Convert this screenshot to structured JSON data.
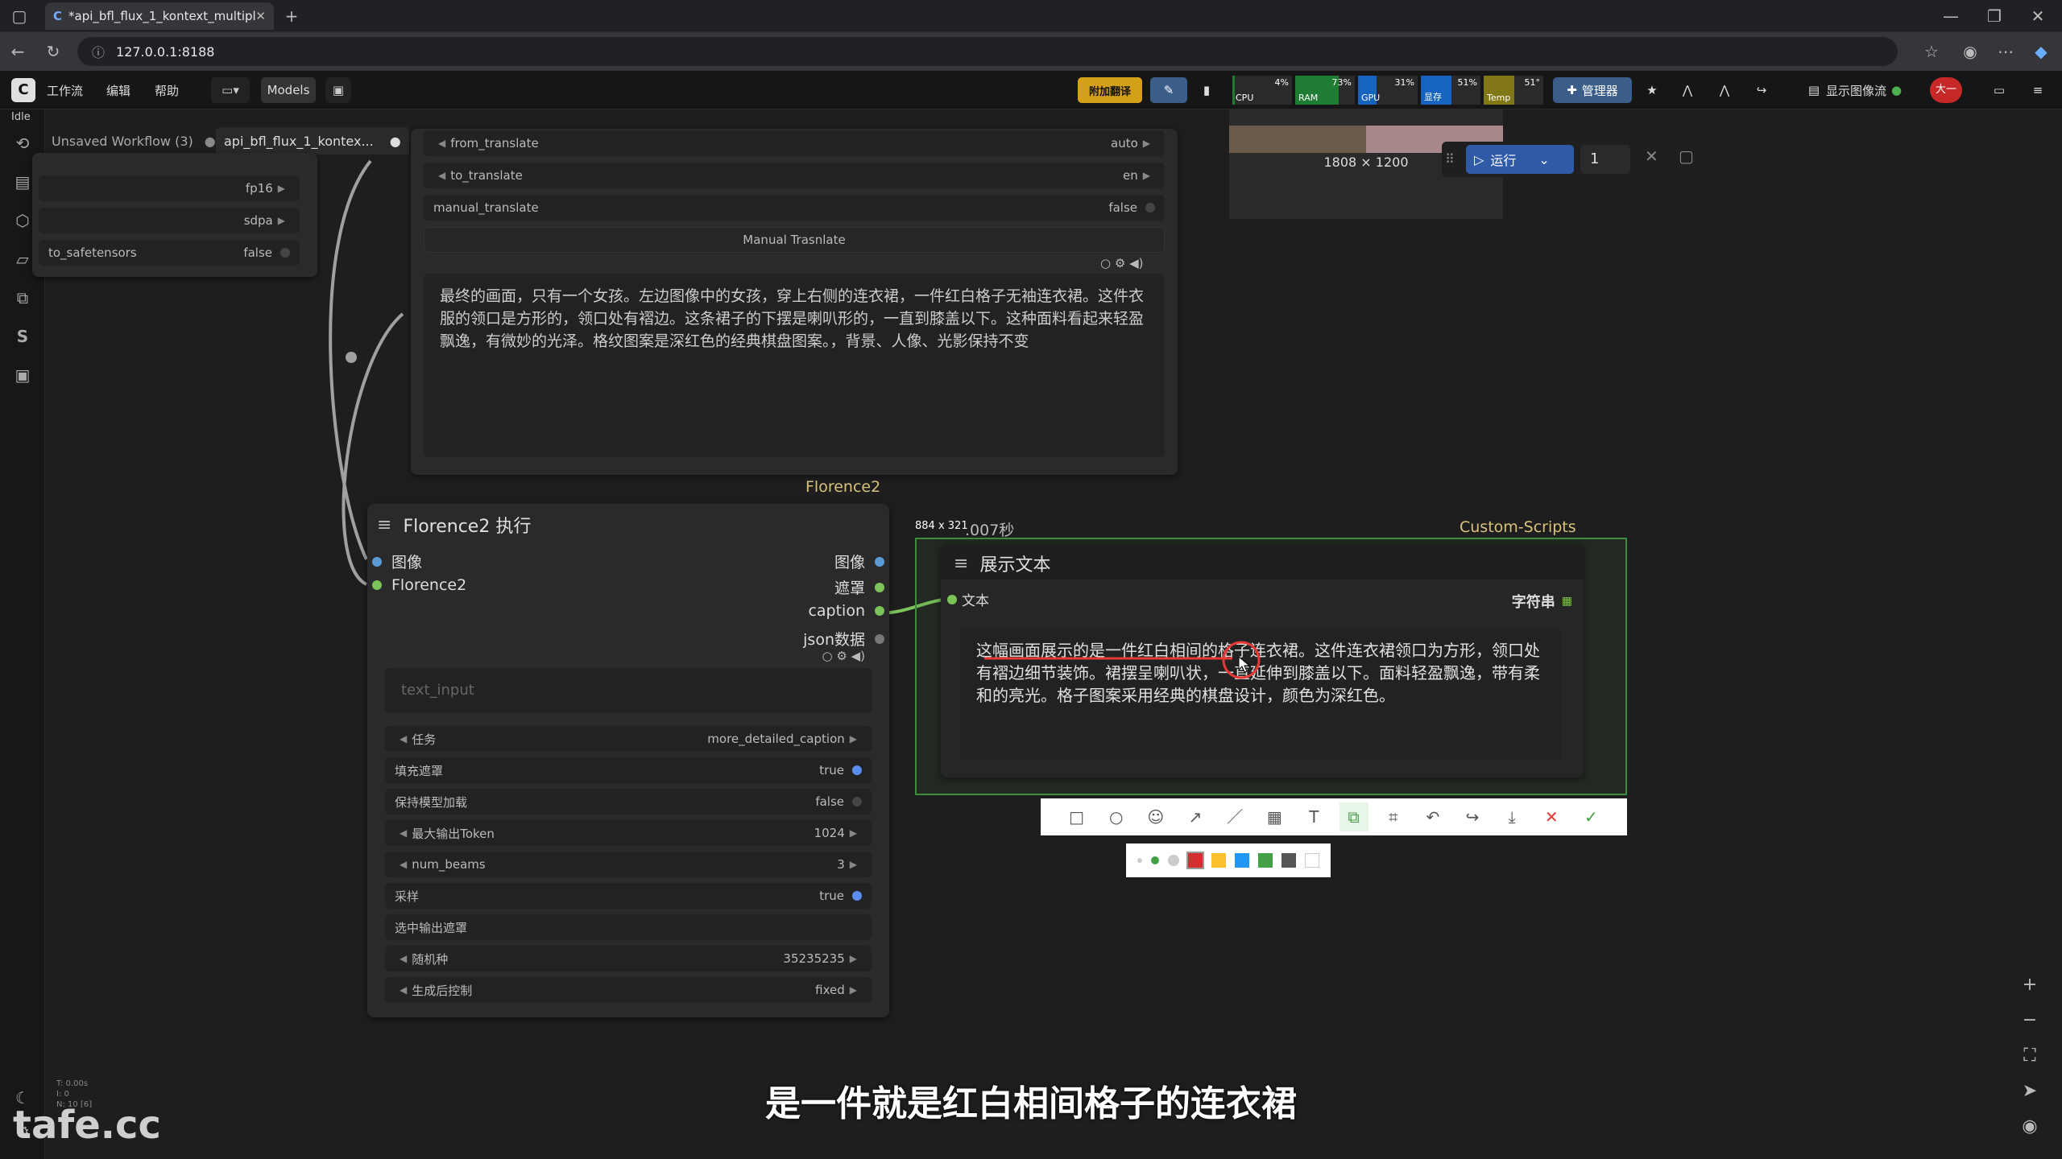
{
  "browser": {
    "tab_title": "*api_bfl_flux_1_kontext_multiple",
    "url": "127.0.0.1:8188"
  },
  "menubar": {
    "items": [
      "工作流",
      "编辑",
      "帮助"
    ],
    "models_label": "Models",
    "translate_label": "附加翻译",
    "meters": [
      {
        "label": "CPU",
        "pct": "4%",
        "color": "#1e7d32",
        "level": 0.04
      },
      {
        "label": "RAM",
        "pct": "73%",
        "color": "#1e7d32",
        "level": 0.73
      },
      {
        "label": "GPU",
        "pct": "31%",
        "color": "#1565c0",
        "level": 0.31
      },
      {
        "label": "显存",
        "pct": "51%",
        "color": "#1565c0",
        "level": 0.51
      },
      {
        "label": "Temp",
        "pct": "51°",
        "color": "#827717",
        "level": 0.51
      }
    ],
    "manager_label": "管理器",
    "show_image_label": "显示图像流",
    "user_label": "大一"
  },
  "status": {
    "idle": "Idle"
  },
  "workflow_tabs": [
    {
      "label": "Unsaved Workflow (3)"
    },
    {
      "label": "api_bfl_flux_1_kontex..."
    }
  ],
  "left_partial_node": {
    "rows": [
      {
        "name": "",
        "value": "fp16"
      },
      {
        "name": "",
        "value": "sdpa"
      },
      {
        "name": "to_safetensors",
        "value": "false"
      }
    ]
  },
  "translate_node": {
    "rows": [
      {
        "name": "from_translate",
        "value": "auto"
      },
      {
        "name": "to_translate",
        "value": "en"
      },
      {
        "name": "manual_translate",
        "value": "false"
      }
    ],
    "button_label": "Manual Trasnlate",
    "text": "最终的画面，只有一个女孩。左边图像中的女孩，穿上右侧的连衣裙，一件红白格子无袖连衣裙。这件衣服的领口是方形的，领口处有褶边。这条裙子的下摆是喇叭形的，一直到膝盖以下。这种面料看起来轻盈飘逸，有微妙的光泽。格纹图案是深红色的经典棋盘图案。，背景、人像、光影保持不变"
  },
  "image_preview": {
    "size_label": "1808 × 1200"
  },
  "run_bar": {
    "run_label": "运行",
    "count": "1"
  },
  "florence_node": {
    "group_label": "Florence2",
    "title": "Florence2 执行",
    "inputs": [
      {
        "label": "图像",
        "color": "#5b9bd5"
      },
      {
        "label": "Florence2",
        "color": "#7cc35a"
      }
    ],
    "outputs": [
      {
        "label": "图像",
        "color": "#5b9bd5"
      },
      {
        "label": "遮罩",
        "color": "#7cc35a"
      },
      {
        "label": "caption",
        "color": "#7cc35a"
      },
      {
        "label": "json数据",
        "color": "#777777"
      }
    ],
    "text_placeholder": "text_input",
    "widgets": [
      {
        "name": "任务",
        "value": "more_detailed_caption",
        "kind": "combo"
      },
      {
        "name": "填充遮罩",
        "value": "true",
        "kind": "toggle-on"
      },
      {
        "name": "保持模型加载",
        "value": "false",
        "kind": "toggle-off"
      },
      {
        "name": "最大输出Token",
        "value": "1024",
        "kind": "combo"
      },
      {
        "name": "num_beams",
        "value": "3",
        "kind": "combo"
      },
      {
        "name": "采样",
        "value": "true",
        "kind": "toggle-on"
      },
      {
        "name": "选中输出遮罩",
        "value": "",
        "kind": "text"
      },
      {
        "name": "随机种",
        "value": "35235235",
        "kind": "combo"
      },
      {
        "name": "生成后控制",
        "value": "fixed",
        "kind": "combo"
      }
    ]
  },
  "display_node": {
    "group_label": "Custom-Scripts",
    "dims_label": "884 x 321",
    "time_label": ".007秒",
    "title": "展示文本",
    "input_label": "文本",
    "output_label": "字符串",
    "text": "这幅画面展示的是一件红白相间的格子连衣裙。这件连衣裙领口为方形，领口处有褶边细节装饰。裙摆呈喇叭状，一直延伸到膝盖以下。面料轻盈飘逸，带有柔和的亮光。格子图案采用经典的棋盘设计，颜色为深红色。"
  },
  "draw_toolbar": {
    "tools": [
      "rectangle-icon",
      "circle-icon",
      "emoji-icon",
      "arrow-icon",
      "pen-icon",
      "mosaic-icon",
      "text-icon",
      "copy-icon",
      "scan-icon",
      "undo-icon",
      "share-icon",
      "save-icon",
      "close-icon",
      "confirm-icon"
    ],
    "colors": [
      "#d32f2f",
      "#fbc02d",
      "#2196f3",
      "#43a047",
      "#555555",
      "#ffffff"
    ]
  },
  "subtitle": "是一件就是红白相间格子的连衣裙",
  "watermark": "tafe.cc",
  "stats": {
    "line1": "T: 0.00s",
    "line2": "I: 0",
    "line3": "N: 10 [6]"
  }
}
